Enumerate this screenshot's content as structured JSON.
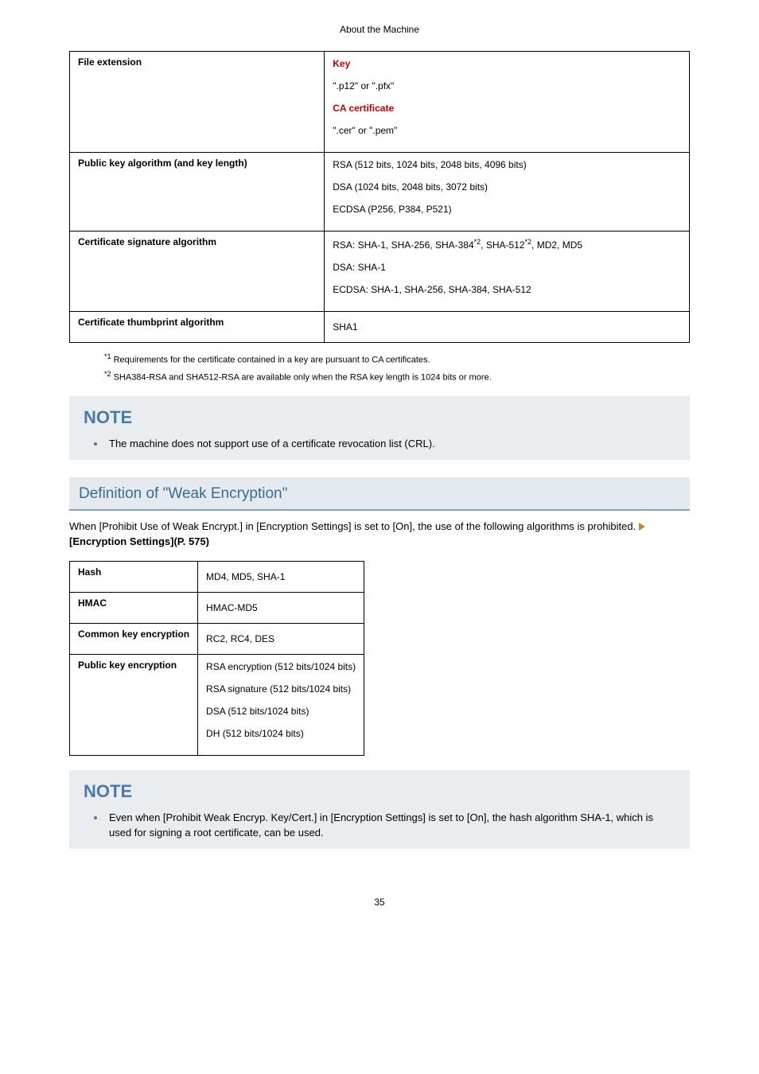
{
  "header": "About the Machine",
  "table1": {
    "r1": {
      "label": "File extension",
      "key": "Key",
      "key_val": "\".p12\" or \".pfx\"",
      "ca": "CA certificate",
      "ca_val": "\".cer\" or \".pem\""
    },
    "r2": {
      "label": "Public key algorithm (and key length)",
      "a": "RSA (512 bits, 1024 bits, 2048 bits, 4096 bits)",
      "b": "DSA (1024 bits, 2048 bits, 3072 bits)",
      "c": "ECDSA (P256, P384, P521)"
    },
    "r3": {
      "label": "Certificate signature algorithm",
      "a_pre": "RSA: SHA-1, SHA-256, SHA-384",
      "a_mid": ", SHA-512",
      "a_post": ", MD2, MD5",
      "b": "DSA: SHA-1",
      "c": "ECDSA: SHA-1, SHA-256, SHA-384, SHA-512"
    },
    "r4": {
      "label": "Certificate thumbprint algorithm",
      "a": "SHA1"
    }
  },
  "footnotes": {
    "f1_marker": "*1",
    "f1": " Requirements for the certificate contained in a key are pursuant to CA certificates.",
    "f2_marker": "*2",
    "f2": " SHA384-RSA and SHA512-RSA are available only when the RSA key length is 1024 bits or more."
  },
  "note1": {
    "heading": "NOTE",
    "bullet1": "The machine does not support use of a certificate revocation list (CRL)."
  },
  "section": {
    "heading": "Definition of \"Weak Encryption\"",
    "body_pre": "When [Prohibit Use of Weak Encrypt.] in [Encryption Settings] is set to [On], the use of the following algorithms is prohibited. ",
    "ref": "[Encryption Settings](P. 575)"
  },
  "table2": {
    "r1": {
      "label": "Hash",
      "val": "MD4, MD5, SHA-1"
    },
    "r2": {
      "label": "HMAC",
      "val": "HMAC-MD5"
    },
    "r3": {
      "label": "Common key encryption",
      "val": "RC2, RC4, DES"
    },
    "r4": {
      "label": "Public key encryption",
      "a": "RSA encryption (512 bits/1024 bits)",
      "b": "RSA signature (512 bits/1024 bits)",
      "c": "DSA (512 bits/1024 bits)",
      "d": "DH (512 bits/1024 bits)"
    }
  },
  "note2": {
    "heading": "NOTE",
    "bullet1": "Even when [Prohibit Weak Encryp. Key/Cert.] in [Encryption Settings] is set to [On], the hash algorithm SHA-1, which is used for signing a root certificate, can be used."
  },
  "page_number": "35",
  "star2": "*2"
}
